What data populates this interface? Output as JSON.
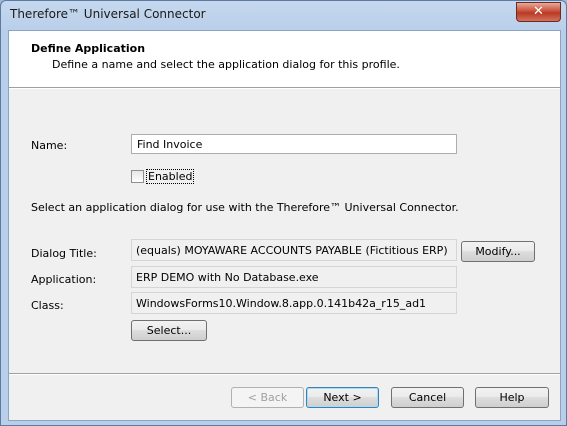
{
  "window": {
    "title": "Therefore™ Universal Connector",
    "close_glyph": "✕"
  },
  "header": {
    "title": "Define Application",
    "subtitle": "Define a name and select the application dialog for this profile."
  },
  "form": {
    "name_label": "Name:",
    "name_value": "Find Invoice",
    "enabled_label": "Enabled",
    "enabled_checked": false,
    "instruction": "Select an application dialog for use with the Therefore™ Universal Connector.",
    "dialog_title_label": "Dialog Title:",
    "dialog_title_value": "(equals) MOYAWARE ACCOUNTS PAYABLE (Fictitious ERP)",
    "modify_label": "Modify...",
    "application_label": "Application:",
    "application_value": "ERP DEMO with No Database.exe",
    "class_label": "Class:",
    "class_value": "WindowsForms10.Window.8.app.0.141b42a_r15_ad1",
    "select_label": "Select..."
  },
  "footer": {
    "back_label": "< Back",
    "next_label": "Next >",
    "cancel_label": "Cancel",
    "help_label": "Help"
  }
}
